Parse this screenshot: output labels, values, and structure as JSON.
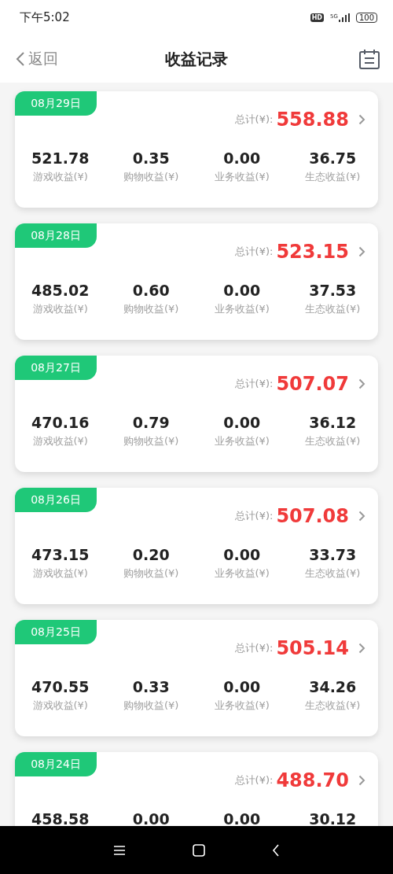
{
  "status_bar": {
    "time": "下午5:02",
    "hd": "HD",
    "network": "5G",
    "battery": "100"
  },
  "header": {
    "back": "返回",
    "title": "收益记录"
  },
  "records": [
    {
      "date": "08月29日",
      "total_label": "总计(¥):",
      "total": "558.88",
      "items": [
        {
          "value": "521.78",
          "label": "游戏收益(¥)"
        },
        {
          "value": "0.35",
          "label": "购物收益(¥)"
        },
        {
          "value": "0.00",
          "label": "业务收益(¥)"
        },
        {
          "value": "36.75",
          "label": "生态收益(¥)"
        }
      ]
    },
    {
      "date": "08月28日",
      "total_label": "总计(¥):",
      "total": "523.15",
      "items": [
        {
          "value": "485.02",
          "label": "游戏收益(¥)"
        },
        {
          "value": "0.60",
          "label": "购物收益(¥)"
        },
        {
          "value": "0.00",
          "label": "业务收益(¥)"
        },
        {
          "value": "37.53",
          "label": "生态收益(¥)"
        }
      ]
    },
    {
      "date": "08月27日",
      "total_label": "总计(¥):",
      "total": "507.07",
      "items": [
        {
          "value": "470.16",
          "label": "游戏收益(¥)"
        },
        {
          "value": "0.79",
          "label": "购物收益(¥)"
        },
        {
          "value": "0.00",
          "label": "业务收益(¥)"
        },
        {
          "value": "36.12",
          "label": "生态收益(¥)"
        }
      ]
    },
    {
      "date": "08月26日",
      "total_label": "总计(¥):",
      "total": "507.08",
      "items": [
        {
          "value": "473.15",
          "label": "游戏收益(¥)"
        },
        {
          "value": "0.20",
          "label": "购物收益(¥)"
        },
        {
          "value": "0.00",
          "label": "业务收益(¥)"
        },
        {
          "value": "33.73",
          "label": "生态收益(¥)"
        }
      ]
    },
    {
      "date": "08月25日",
      "total_label": "总计(¥):",
      "total": "505.14",
      "items": [
        {
          "value": "470.55",
          "label": "游戏收益(¥)"
        },
        {
          "value": "0.33",
          "label": "购物收益(¥)"
        },
        {
          "value": "0.00",
          "label": "业务收益(¥)"
        },
        {
          "value": "34.26",
          "label": "生态收益(¥)"
        }
      ]
    },
    {
      "date": "08月24日",
      "total_label": "总计(¥):",
      "total": "488.70",
      "items": [
        {
          "value": "458.58"
        },
        {
          "value": "0.00"
        },
        {
          "value": "0.00"
        },
        {
          "value": "30.12"
        }
      ]
    }
  ]
}
